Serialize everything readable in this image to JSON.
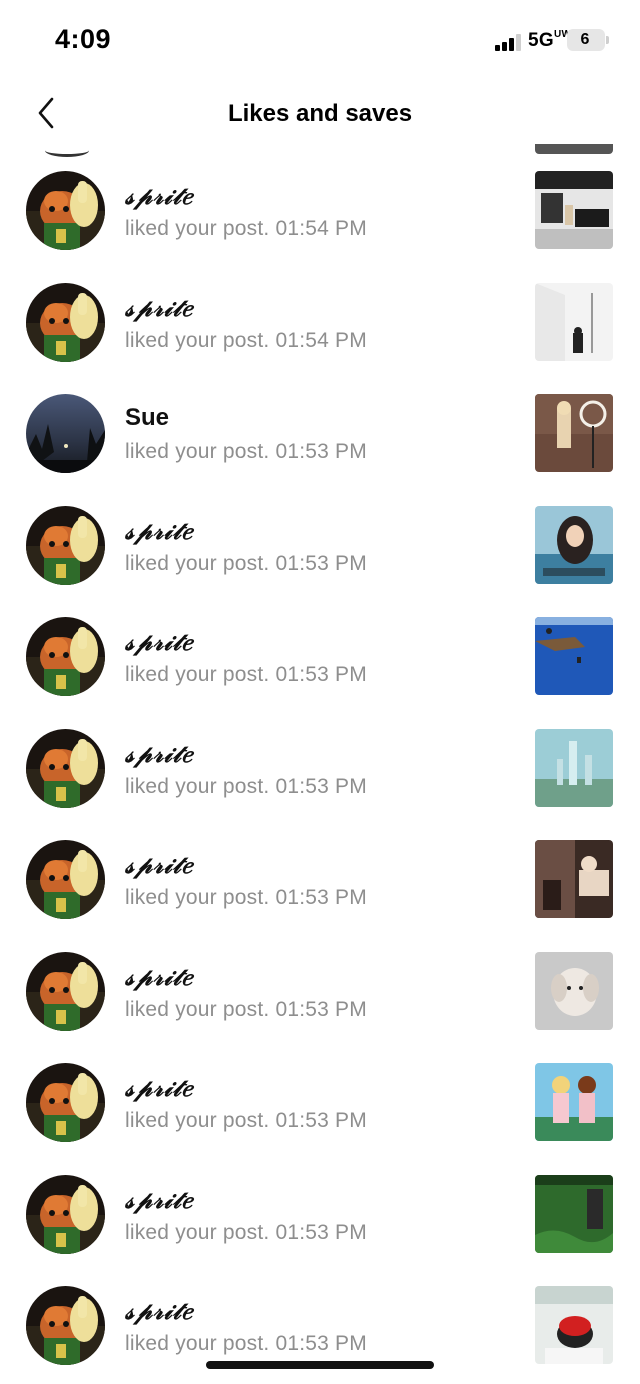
{
  "status_bar": {
    "time": "4:09",
    "network": "5G",
    "network_sup": "UW",
    "battery": "6"
  },
  "header": {
    "title": "Likes and saves",
    "back_icon": "chevron-left-icon"
  },
  "colors": {
    "secondary_text": "#8e8e8e",
    "background": "#ffffff"
  },
  "notifications": [
    {
      "user": "𝓈𝓅𝓇𝒾𝓉𝑒",
      "text": "liked your post. 01:54 PM",
      "avatar": "sprite",
      "thumb": "room-dark"
    },
    {
      "user": "𝓈𝓅𝓇𝒾𝓉𝑒",
      "text": "liked your post. 01:54 PM",
      "avatar": "sprite",
      "thumb": "room-white"
    },
    {
      "user": "Sue",
      "text": "liked your post. 01:53 PM",
      "avatar": "night-sky",
      "thumb": "ring-light"
    },
    {
      "user": "𝓈𝓅𝓇𝒾𝓉𝑒",
      "text": "liked your post. 01:53 PM",
      "avatar": "sprite",
      "thumb": "girl-ocean"
    },
    {
      "user": "𝓈𝓅𝓇𝒾𝓉𝑒",
      "text": "liked your post. 01:53 PM",
      "avatar": "sprite",
      "thumb": "blue-water"
    },
    {
      "user": "𝓈𝓅𝓇𝒾𝓉𝑒",
      "text": "liked your post. 01:53 PM",
      "avatar": "sprite",
      "thumb": "city-sky"
    },
    {
      "user": "𝓈𝓅𝓇𝒾𝓉𝑒",
      "text": "liked your post. 01:53 PM",
      "avatar": "sprite",
      "thumb": "room-pose"
    },
    {
      "user": "𝓈𝓅𝓇𝒾𝓉𝑒",
      "text": "liked your post. 01:53 PM",
      "avatar": "sprite",
      "thumb": "grey-dog"
    },
    {
      "user": "𝓈𝓅𝓇𝒾𝓉𝑒",
      "text": "liked your post. 01:53 PM",
      "avatar": "sprite",
      "thumb": "dancers"
    },
    {
      "user": "𝓈𝓅𝓇𝒾𝓉𝑒",
      "text": "liked your post. 01:53 PM",
      "avatar": "sprite",
      "thumb": "green-field"
    },
    {
      "user": "𝓈𝓅𝓇𝒾𝓉𝑒",
      "text": "liked your post. 01:53 PM",
      "avatar": "sprite",
      "thumb": "red-cap"
    }
  ]
}
